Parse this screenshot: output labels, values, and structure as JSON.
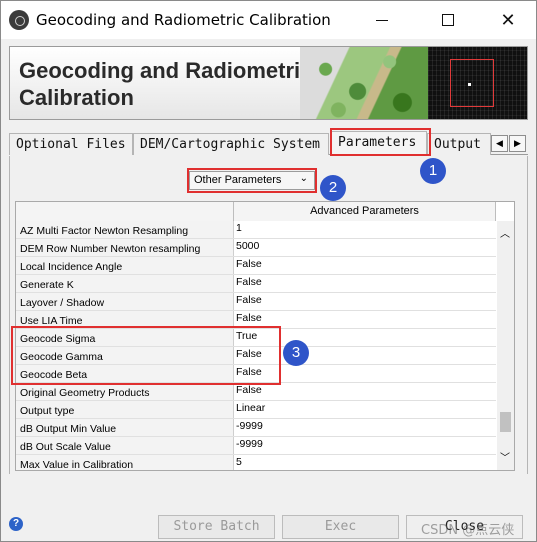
{
  "window": {
    "title": "Geocoding and Radiometric Calibration",
    "controls": {
      "minimize": "—",
      "maximize": "☐",
      "close": "✕"
    }
  },
  "banner": {
    "title": "Geocoding and Radiometric\nCalibration"
  },
  "tabs": [
    {
      "label": "Optional Files"
    },
    {
      "label": "DEM/Cartographic System"
    },
    {
      "label": "Parameters",
      "active": true
    },
    {
      "label": "Output F"
    }
  ],
  "tab_scroll": {
    "left": "◀",
    "right": "▶"
  },
  "dropdown": {
    "selected": "Other Parameters",
    "chevron": "⌄"
  },
  "table": {
    "header": "Advanced Parameters",
    "rows": [
      {
        "name": "AZ Multi Factor Newton Resampling",
        "value": "1"
      },
      {
        "name": "DEM Row Number Newton resampling",
        "value": "5000"
      },
      {
        "name": "Local Incidence Angle",
        "value": "False"
      },
      {
        "name": "Generate K",
        "value": "False"
      },
      {
        "name": "Layover / Shadow",
        "value": "False"
      },
      {
        "name": "Use LIA Time",
        "value": "False"
      },
      {
        "name": "Geocode Sigma",
        "value": "True"
      },
      {
        "name": "Geocode Gamma",
        "value": "False"
      },
      {
        "name": "Geocode Beta",
        "value": "False"
      },
      {
        "name": "Original Geometry Products",
        "value": "False"
      },
      {
        "name": "Output type",
        "value": "Linear"
      },
      {
        "name": "dB Output Min Value",
        "value": "-9999"
      },
      {
        "name": "dB Out Scale Value",
        "value": "-9999"
      },
      {
        "name": "Max Value in Calibration",
        "value": "5"
      }
    ],
    "scroll": {
      "up": "︿",
      "down": "﹀"
    }
  },
  "annotations": {
    "badge1": "1",
    "badge2": "2",
    "badge3": "3",
    "highlight_color": "#e02f2f",
    "badge_color": "#2f55c9"
  },
  "buttons": {
    "help": "?",
    "store_batch": "Store Batch",
    "exec": "Exec",
    "close": "Close"
  },
  "watermark": "CSDN @点云侠"
}
